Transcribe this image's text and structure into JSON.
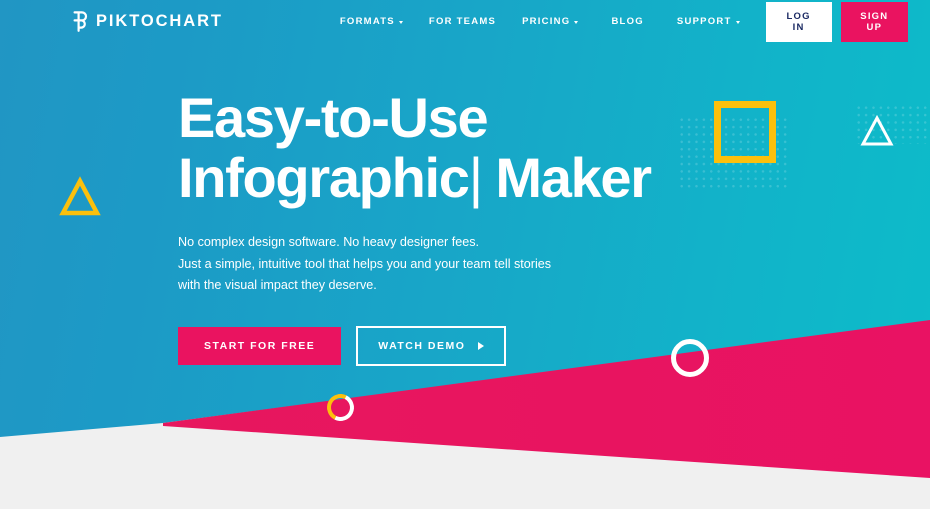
{
  "brand": {
    "name": "PIKTOCHART",
    "logo_icon": "piktochart-p-mark",
    "accent_pink": "#ea1360",
    "accent_yellow": "#fcc00c",
    "background_teal": "#18a6c8",
    "footer_grey": "#f0f0f0"
  },
  "nav": {
    "items": [
      {
        "label": "FORMATS",
        "has_caret": true
      },
      {
        "label": "FOR TEAMS",
        "has_caret": false
      },
      {
        "label": "PRICING",
        "has_caret": true
      },
      {
        "label": "BLOG",
        "has_caret": false
      },
      {
        "label": "SUPPORT",
        "has_caret": true
      }
    ],
    "login_label": "LOG IN",
    "signup_label": "SIGN UP"
  },
  "hero": {
    "headline_line1": "Easy-to-Use",
    "headline_line2": "Infographic",
    "headline_cursor": "|",
    "headline_line2_tail": " Maker",
    "sub_line1": "No complex design software. No heavy designer fees.",
    "sub_line2": "Just a simple, intuitive tool that helps you and your team tell stories",
    "sub_line3": "with the visual impact they deserve.",
    "cta_primary": "START FOR FREE",
    "cta_secondary": "WATCH DEMO",
    "cta_secondary_icon": "play-triangle-icon"
  },
  "decorations": {
    "square_outline": "yellow-square-outline",
    "triangle_left": "yellow-triangle-outline",
    "triangle_right": "white-triangle-outline",
    "ring_large": "white-circle-outline",
    "ring_small": "yellow-white-circle-outline",
    "dot_grid": "dot-grid-pattern",
    "wedge_pink": "pink-diagonal-wedge",
    "wedge_grey": "grey-diagonal-base"
  }
}
